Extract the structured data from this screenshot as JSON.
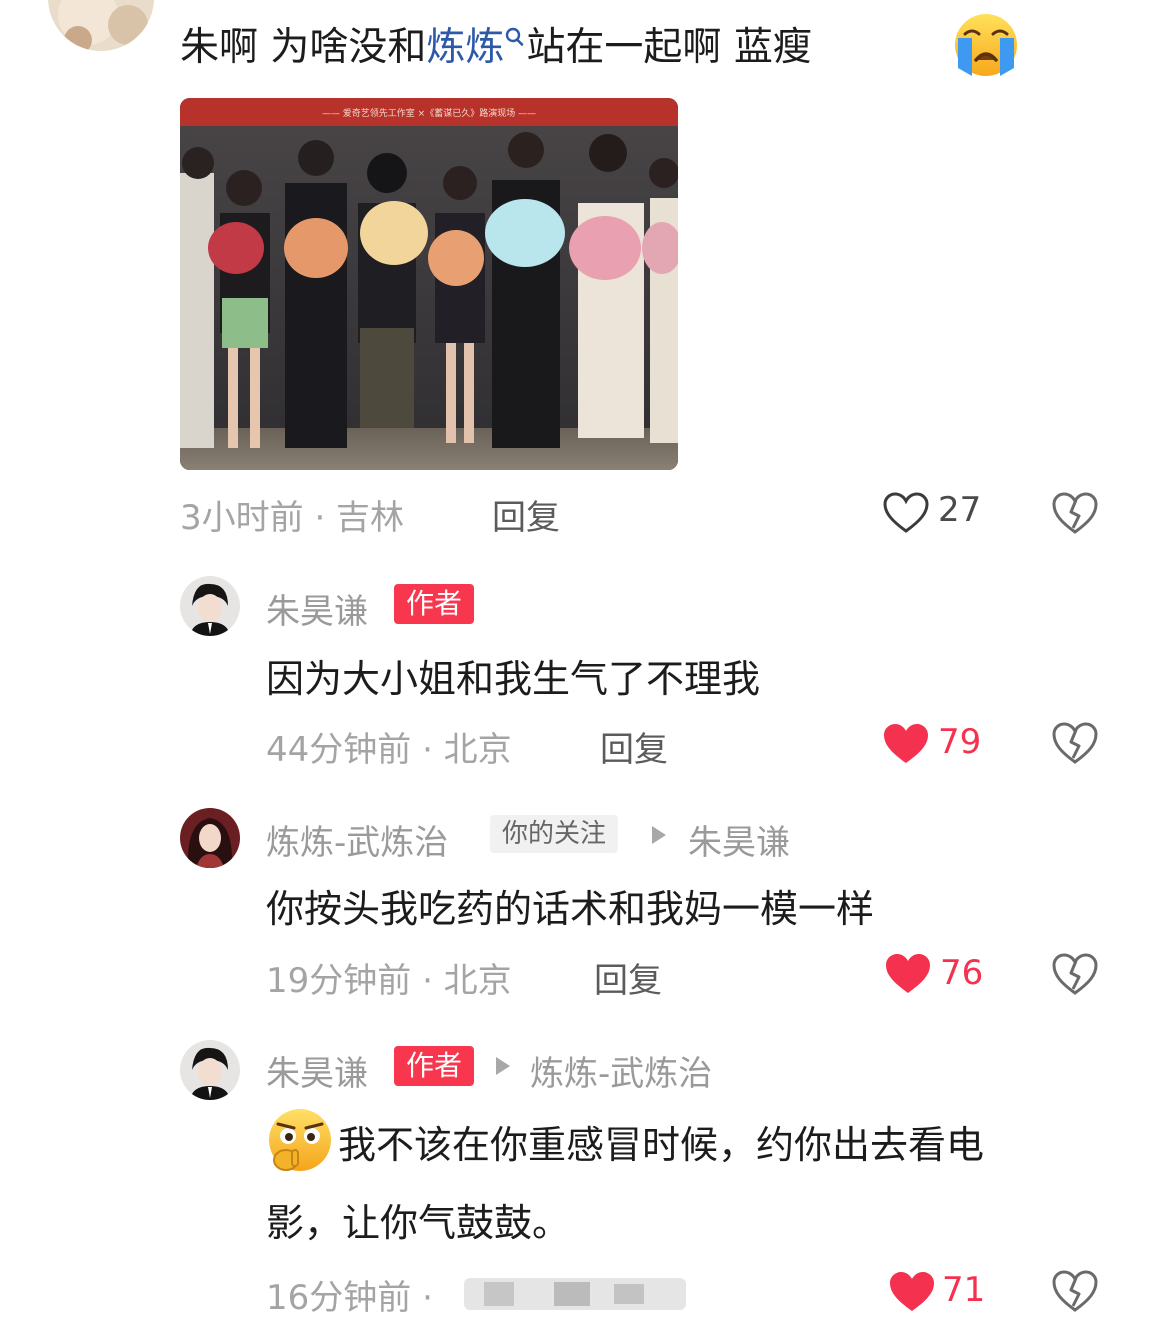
{
  "top_comment": {
    "text_before": "朱啊  为啥没和",
    "text_link": "炼炼",
    "text_after": "站在一起啊   蓝瘦",
    "banner_text": "—— 爱奇艺领先工作室 ×《蓄谋已久》路演现场 ——",
    "time_location": "3小时前 · 吉林",
    "reply_label": "回复",
    "like_count": "27",
    "liked": false
  },
  "replies": [
    {
      "name": "朱昊谦",
      "badge": "作者",
      "text": "因为大小姐和我生气了不理我",
      "time_location": "44分钟前 · 北京",
      "reply_label": "回复",
      "like_count": "79",
      "liked": true
    },
    {
      "name": "炼炼-武炼治",
      "badge": "你的关注",
      "reply_to": "朱昊谦",
      "text": "你按头我吃药的话术和我妈一模一样",
      "time_location": "19分钟前 · 北京",
      "reply_label": "回复",
      "like_count": "76",
      "liked": true
    },
    {
      "name": "朱昊谦",
      "badge": "作者",
      "reply_to": "炼炼-武炼治",
      "text_line1": "我不该在你重感冒时候，约你出去看电",
      "text_line2": "影，让你气鼓鼓。",
      "time_location": "16分钟前 ·",
      "like_count": "71",
      "liked": true
    }
  ],
  "colors": {
    "liked": "#f4324f",
    "author_badge": "#f8364e",
    "link": "#2c5aa8",
    "meta": "#a4a4a4"
  }
}
